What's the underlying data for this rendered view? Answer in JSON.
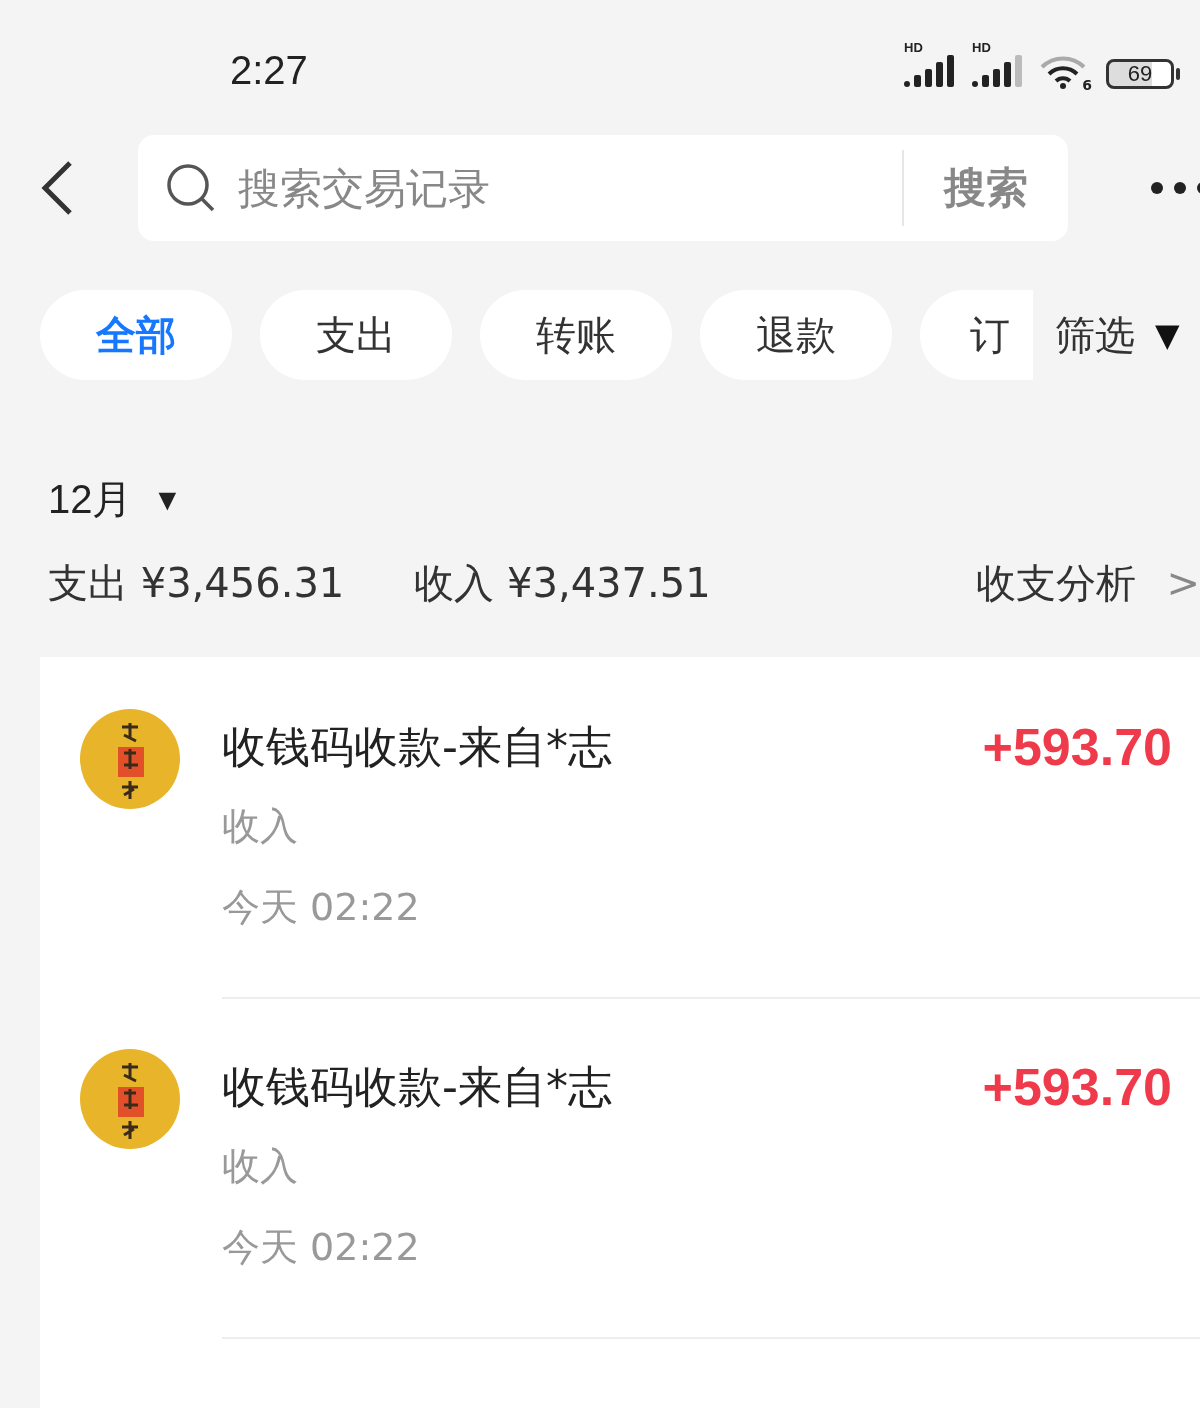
{
  "status_bar": {
    "time": "2:27",
    "signal_1_label": "HD",
    "signal_2_label": "HD",
    "wifi_label": "6",
    "battery": "69"
  },
  "search": {
    "placeholder": "搜索交易记录",
    "button": "搜索"
  },
  "tabs": [
    {
      "label": "全部",
      "selected": true
    },
    {
      "label": "支出",
      "selected": false
    },
    {
      "label": "转账",
      "selected": false
    },
    {
      "label": "退款",
      "selected": false
    },
    {
      "label": "订",
      "selected": false
    }
  ],
  "filter": {
    "label": "筛选",
    "caret": "▼"
  },
  "month": {
    "label": "12月",
    "caret": "▼"
  },
  "summary": {
    "expense": "支出 ¥3,456.31",
    "income": "收入 ¥3,437.51",
    "analysis": "收支分析",
    "chevron": ">"
  },
  "transactions": [
    {
      "title": "收钱码收款-来自*志",
      "category": "收入",
      "time": "今天 02:22",
      "amount": "+593.70",
      "kind": "income"
    },
    {
      "title": "收钱码收款-来自*志",
      "category": "收入",
      "time": "今天 02:22",
      "amount": "+593.70",
      "kind": "income"
    }
  ]
}
